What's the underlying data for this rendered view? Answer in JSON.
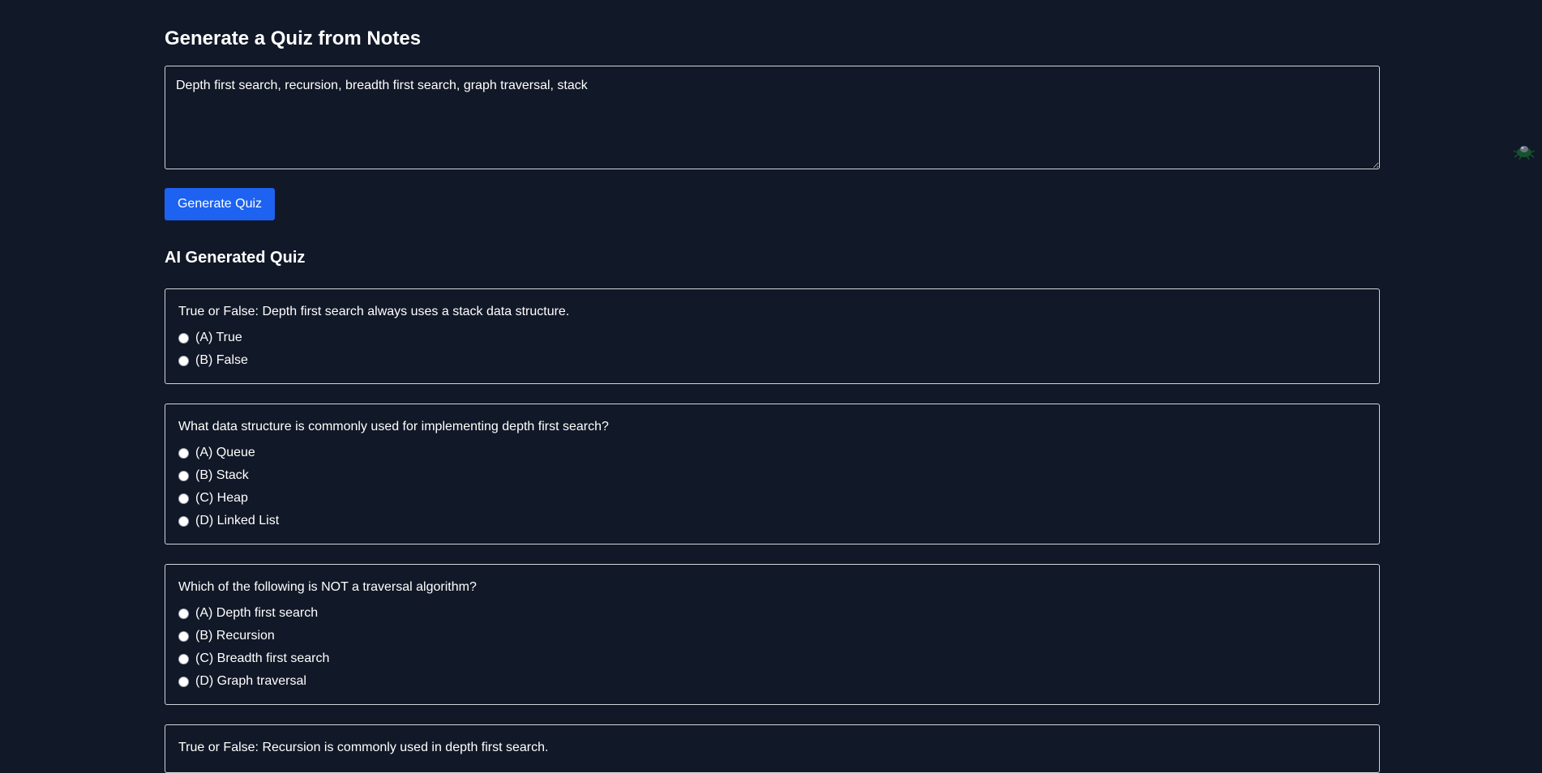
{
  "page": {
    "title": "Generate a Quiz from Notes"
  },
  "notes_input": {
    "value": "Depth first search, recursion, breadth first search, graph traversal, stack"
  },
  "generate_button": {
    "label": "Generate Quiz"
  },
  "quiz": {
    "title": "AI Generated Quiz",
    "questions": [
      {
        "text": "True or False: Depth first search always uses a stack data structure.",
        "options": [
          "(A) True",
          "(B) False"
        ]
      },
      {
        "text": "What data structure is commonly used for implementing depth first search?",
        "options": [
          "(A) Queue",
          "(B) Stack",
          "(C) Heap",
          "(D) Linked List"
        ]
      },
      {
        "text": "Which of the following is NOT a traversal algorithm?",
        "options": [
          "(A) Depth first search",
          "(B) Recursion",
          "(C) Breadth first search",
          "(D) Graph traversal"
        ]
      },
      {
        "text": "True or False: Recursion is commonly used in depth first search.",
        "options": []
      }
    ]
  },
  "side_icon": {
    "name": "bug-icon",
    "color": "#14532d"
  },
  "colors": {
    "background": "#111827",
    "accent": "#1d62f0",
    "border": "#d1d5db"
  }
}
